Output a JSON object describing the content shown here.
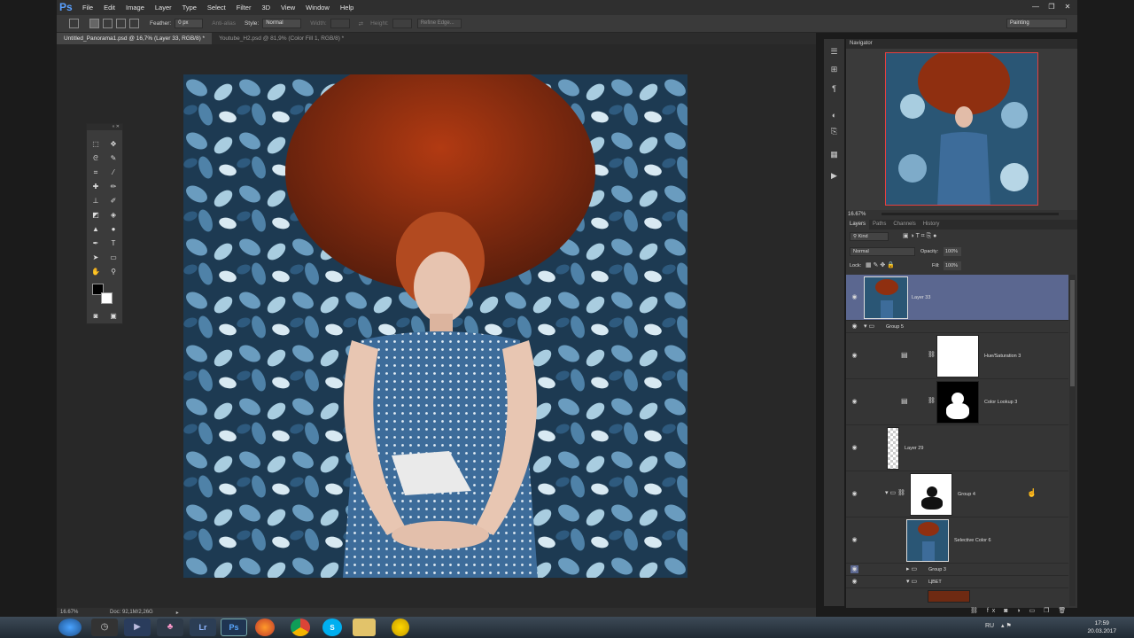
{
  "app": {
    "logo": "Ps"
  },
  "menu": [
    "File",
    "Edit",
    "Image",
    "Layer",
    "Type",
    "Select",
    "Filter",
    "3D",
    "View",
    "Window",
    "Help"
  ],
  "window_controls": [
    "minimize-icon",
    "restore-icon",
    "close-icon"
  ],
  "options": {
    "feather_label": "Feather:",
    "feather_value": "0 px",
    "antialias_label": "Anti-alias",
    "style_label": "Style:",
    "style_value": "Normal",
    "width_label": "Width:",
    "height_label": "Height:",
    "refine_label": "Refine Edge...",
    "workspace": "Painting"
  },
  "doc_tabs": [
    "Untitled_Panorama1.psd @ 16,7% (Layer 33, RGB/8) *",
    "Youtube_H2.psd @ 81,9% (Color Fill 1, RGB/8) *"
  ],
  "status": {
    "zoom": "16.67%",
    "doc": "Doc: 92,1M/2,26G"
  },
  "navigator": {
    "title": "Navigator",
    "zoom": "16.67%"
  },
  "layers_tabs": [
    "Layers",
    "Paths",
    "Channels",
    "History"
  ],
  "layers_controls": {
    "kind": "Kind",
    "blend": "Normal",
    "opacity_label": "Opacity:",
    "opacity": "100%",
    "lock_label": "Lock:",
    "fill_label": "Fill:",
    "fill": "100%"
  },
  "layers": [
    {
      "name": "Layer 33"
    },
    {
      "name": "Group 5"
    },
    {
      "name": "Hue/Saturation 3"
    },
    {
      "name": "Color Lookup 3"
    },
    {
      "name": "Layer 29"
    },
    {
      "name": "Group 4"
    },
    {
      "name": "Selective Color 6"
    },
    {
      "name": "Group 3"
    },
    {
      "name": "ЦВЕТ"
    }
  ],
  "taskbar": {
    "lang": "RU",
    "time": "17:59",
    "date": "20.03.2017",
    "apps": [
      "start-icon",
      "clock-app-icon",
      "media-player-icon",
      "people-icon",
      "lightroom-icon",
      "photoshop-icon",
      "firefox-icon",
      "chrome-icon",
      "skype-icon",
      "explorer-icon",
      "yellow-app-icon"
    ],
    "lr_label": "Lr",
    "ps_label": "Ps"
  },
  "colors": {
    "accent": "#5b6790",
    "canvas_bg": "#282828",
    "panel_bg": "#353535"
  }
}
